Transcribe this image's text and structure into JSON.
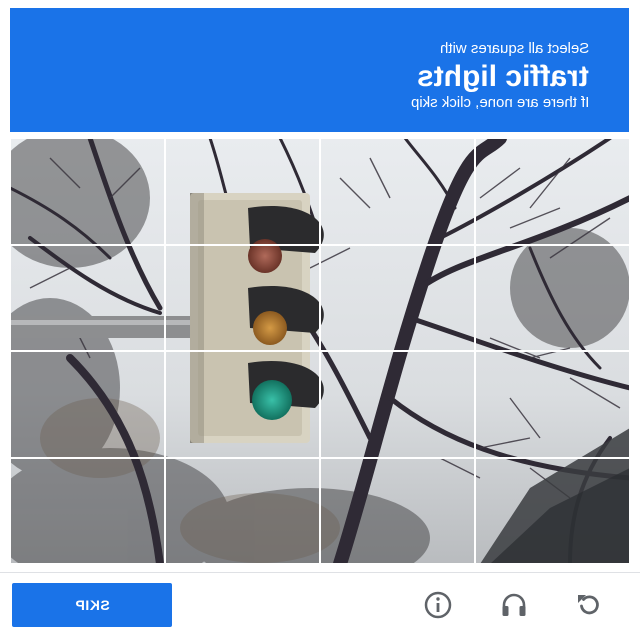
{
  "header": {
    "instruction_line": "Select all squares with",
    "target_object": "traffic lights",
    "fallback_line": "If there are none, click skip",
    "background_color": "#1a73e8"
  },
  "grid": {
    "rows": 4,
    "columns": 4,
    "tiles": [
      {
        "row": 1,
        "col": 1
      },
      {
        "row": 1,
        "col": 2
      },
      {
        "row": 1,
        "col": 3
      },
      {
        "row": 1,
        "col": 4
      },
      {
        "row": 2,
        "col": 1
      },
      {
        "row": 2,
        "col": 2
      },
      {
        "row": 2,
        "col": 3
      },
      {
        "row": 2,
        "col": 4
      },
      {
        "row": 3,
        "col": 1
      },
      {
        "row": 3,
        "col": 2
      },
      {
        "row": 3,
        "col": 3
      },
      {
        "row": 3,
        "col": 4
      },
      {
        "row": 4,
        "col": 1
      },
      {
        "row": 4,
        "col": 2
      },
      {
        "row": 4,
        "col": 3
      },
      {
        "row": 4,
        "col": 4
      }
    ]
  },
  "footer": {
    "skip_label": "SKIP",
    "icons": [
      "info-icon",
      "headphones-icon",
      "reload-icon"
    ]
  }
}
